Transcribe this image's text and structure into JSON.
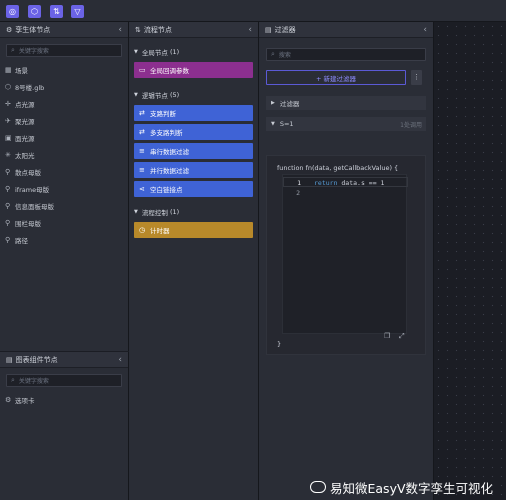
{
  "toolbar": {
    "buttons": [
      {
        "icon": "box-icon",
        "glyph": "◎"
      },
      {
        "icon": "cube-icon",
        "glyph": "⬡"
      },
      {
        "icon": "link-icon",
        "glyph": "⇅"
      },
      {
        "icon": "filter-icon",
        "glyph": "▽"
      }
    ],
    "accent": "#6b63e6"
  },
  "twin_panel": {
    "title": "孪生体节点",
    "search_placeholder": "关键字搜索",
    "items": [
      {
        "label": "场景",
        "icon": "scene-icon",
        "glyph": "▦"
      },
      {
        "label": "8号楼.glb",
        "icon": "model-icon",
        "glyph": "⬡"
      },
      {
        "label": "点光源",
        "icon": "point-light-icon",
        "glyph": "✛"
      },
      {
        "label": "聚光源",
        "icon": "spot-light-icon",
        "glyph": "✈"
      },
      {
        "label": "面光源",
        "icon": "area-light-icon",
        "glyph": "▣"
      },
      {
        "label": "太阳光",
        "icon": "sun-icon",
        "glyph": "✳"
      },
      {
        "label": "散点母版",
        "icon": "template-icon",
        "glyph": "⚲"
      },
      {
        "label": "iframe母版",
        "icon": "template-icon",
        "glyph": "⚲"
      },
      {
        "label": "信息面板母版",
        "icon": "template-icon",
        "glyph": "⚲"
      },
      {
        "label": "围栏母版",
        "icon": "template-icon",
        "glyph": "⚲"
      },
      {
        "label": "路径",
        "icon": "path-icon",
        "glyph": "⚲"
      }
    ]
  },
  "chart_panel": {
    "title": "图表组件节点",
    "search_placeholder": "关键字搜索",
    "items": [
      {
        "label": "选项卡",
        "icon": "tab-component-icon",
        "glyph": "⚙"
      }
    ]
  },
  "flow_panel": {
    "title": "流程节点",
    "groups": [
      {
        "title": "全局节点",
        "count": "(1)",
        "nodes": [
          {
            "label": "全局回调参数",
            "color": "#8c2f8f",
            "glyph": "▭"
          }
        ]
      },
      {
        "title": "逻辑节点",
        "count": "(5)",
        "nodes": [
          {
            "label": "支路判断",
            "color": "#3f63d6",
            "glyph": "⇄"
          },
          {
            "label": "多支路判断",
            "color": "#3f63d6",
            "glyph": "⇄"
          },
          {
            "label": "串行数据过滤",
            "color": "#3f63d6",
            "glyph": "≡"
          },
          {
            "label": "并行数据过滤",
            "color": "#3f63d6",
            "glyph": "≡"
          },
          {
            "label": "空白链接点",
            "color": "#3f63d6",
            "glyph": "⋖"
          }
        ]
      },
      {
        "title": "流程控制",
        "count": "(1)",
        "nodes": [
          {
            "label": "计时器",
            "color": "#b8892a",
            "glyph": "◷"
          }
        ]
      }
    ]
  },
  "filter_panel": {
    "title": "过滤器",
    "search_placeholder": "搜索",
    "add_label": "+ 新建过滤器",
    "more_label": "⋮",
    "group_label": "过滤器",
    "item_label": "S=1",
    "item_aux": "1处调用",
    "code_signature": "function fn(data, getCallbackValue) {",
    "code_lines": [
      {
        "num": "1",
        "keyword": "return",
        "rest": " data.s == 1"
      },
      {
        "num": "2",
        "keyword": "",
        "rest": ""
      }
    ],
    "code_close": "}"
  },
  "watermark": "易知微EasyV数字孪生可视化"
}
